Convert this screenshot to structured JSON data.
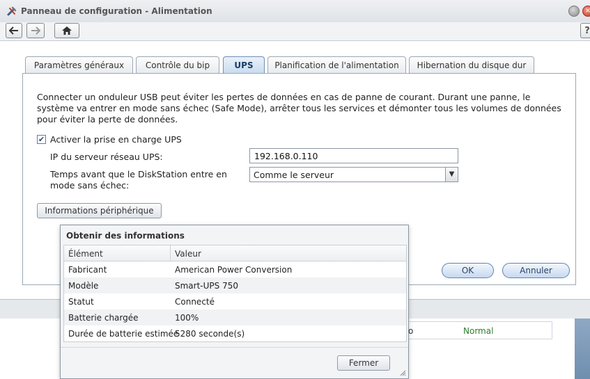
{
  "window": {
    "title": "Panneau de configuration - Alimentation",
    "help_label": "?"
  },
  "tabs": [
    {
      "label": "Paramètres généraux"
    },
    {
      "label": "Contrôle du bip"
    },
    {
      "label": "UPS"
    },
    {
      "label": "Planification de l'alimentation"
    },
    {
      "label": "Hibernation du disque dur"
    }
  ],
  "ups_tab": {
    "description": "Connecter un onduleur USB peut éviter les pertes de données en cas de panne de courant. Durant une panne, le système va entrer en mode sans échec (Safe Mode), arrêter tous les services et démonter tous les volumes de données pour éviter la perte de données.",
    "enable_ups_label": "Activer la prise en charge UPS",
    "enable_ups_checked": true,
    "ip_label": "IP du serveur réseau UPS:",
    "ip_value": "192.168.0.110",
    "time_label": "Temps avant que le DiskStation entre en mode sans échec:",
    "time_value": "Comme le serveur",
    "device_info_button": "Informations périphérique"
  },
  "buttons": {
    "ok": "OK",
    "cancel": "Annuler"
  },
  "background_row": {
    "left_fragment": "o",
    "status": "Normal",
    "status_color": "#2f7d2f"
  },
  "dialog": {
    "title": "Obtenir des informations",
    "columns": [
      "Élément",
      "Valeur"
    ],
    "rows": [
      {
        "element": "Fabricant",
        "value": "American Power Conversion"
      },
      {
        "element": "Modèle",
        "value": "Smart-UPS 750"
      },
      {
        "element": "Statut",
        "value": "Connecté"
      },
      {
        "element": "Batterie chargée",
        "value": "100%"
      },
      {
        "element": "Durée de batterie estimée",
        "value": "5280 seconde(s)"
      }
    ],
    "close_button": "Fermer"
  }
}
